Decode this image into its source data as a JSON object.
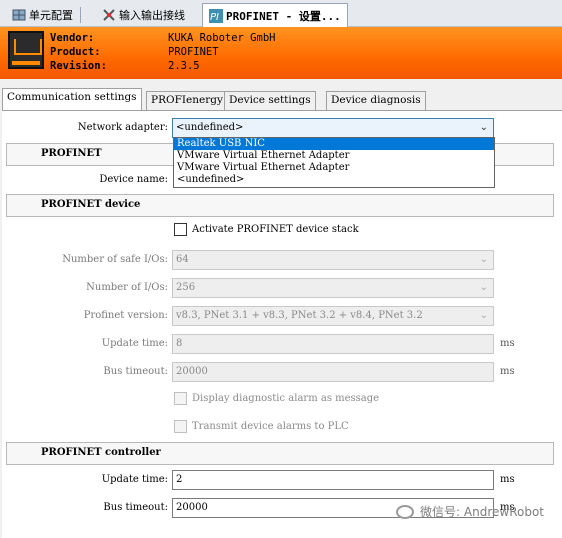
{
  "doc_tabs": [
    {
      "label": "单元配置",
      "icon": "grid-icon"
    },
    {
      "label": "输入输出接线",
      "icon": "wiring-icon"
    },
    {
      "label": "PROFINET - 设置...",
      "icon": "profinet-icon"
    }
  ],
  "header": {
    "vendor_key": "Vendor:",
    "vendor_val": "KUKA Roboter GmbH",
    "product_key": "Product:",
    "product_val": "PROFINET",
    "revision_key": "Revision:",
    "revision_val": "2.3.5",
    "bg": "#ff7a00"
  },
  "tabs": [
    "Communication settings",
    "PROFIenergy",
    "Device settings",
    "Device diagnosis"
  ],
  "network": {
    "label": "Network adapter:",
    "value": "<undefined>",
    "options": [
      "Realtek USB NIC",
      "VMware Virtual Ethernet Adapter",
      "VMware Virtual Ethernet Adapter",
      "<undefined>"
    ],
    "selected_index": 0
  },
  "sec_profinet": {
    "title": "PROFINET",
    "device_name_label": "Device name:"
  },
  "sec_device": {
    "title": "PROFINET device",
    "activate_label": "Activate PROFINET device stack",
    "safe_io_label": "Number of safe I/Os:",
    "safe_io_value": "64",
    "io_label": "Number of I/Os:",
    "io_value": "256",
    "version_label": "Profinet version:",
    "version_value": "v8.3, PNet 3.1 + v8.3, PNet 3.2 + v8.4, PNet 3.2",
    "update_label": "Update time:",
    "update_value": "8",
    "update_unit": "ms",
    "bus_label": "Bus timeout:",
    "bus_value": "20000",
    "bus_unit": "ms",
    "diag_label": "Display diagnostic alarm as message",
    "transmit_label": "Transmit device alarms to PLC"
  },
  "sec_controller": {
    "title": "PROFINET controller",
    "update_label": "Update time:",
    "update_value": "2",
    "update_unit": "ms",
    "bus_label": "Bus timeout:",
    "bus_value": "20000",
    "bus_unit": "ms"
  },
  "watermark": "微信号: AndrewRobot"
}
